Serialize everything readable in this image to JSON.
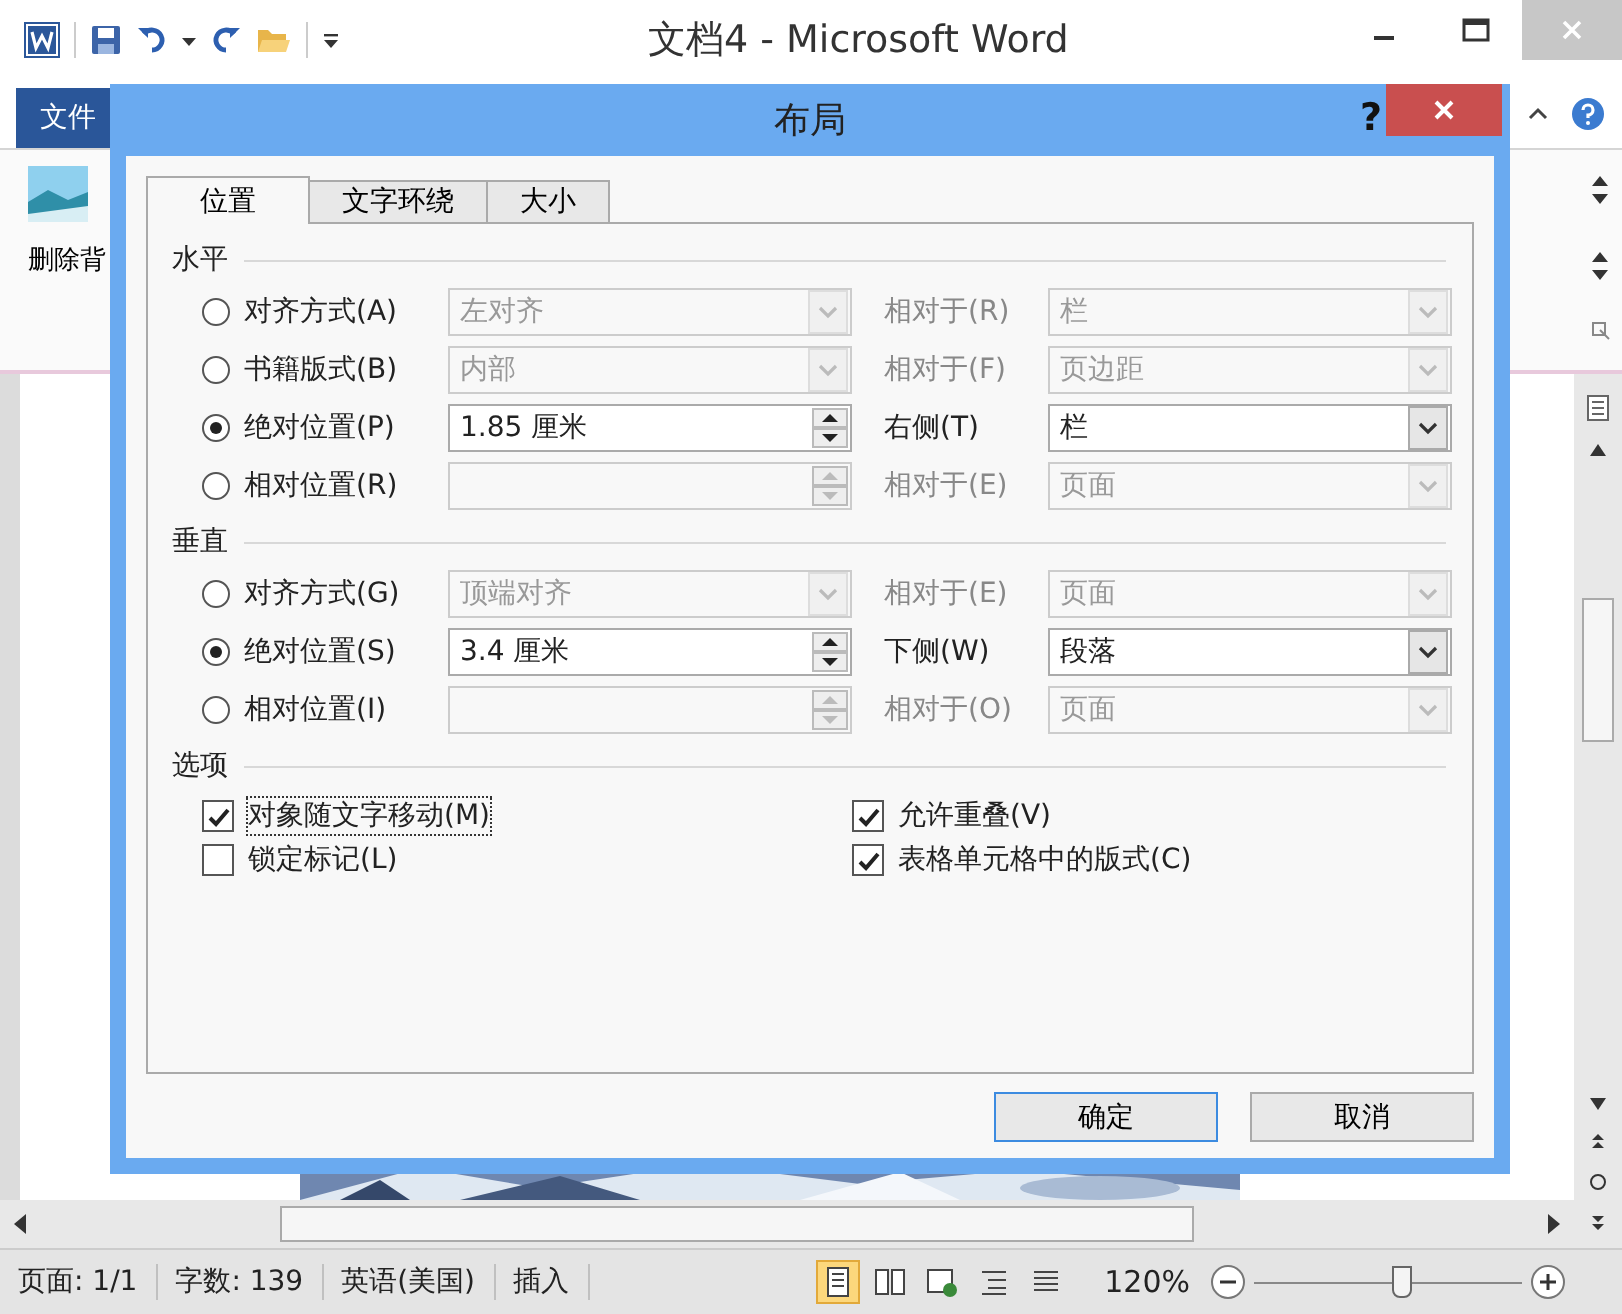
{
  "window": {
    "title": "文档4 - Microsoft Word"
  },
  "ribbon": {
    "file_tab": "文件",
    "button": "删除背"
  },
  "dialog": {
    "title": "布局",
    "help": "?",
    "tabs": [
      {
        "label": "位置",
        "selected": true
      },
      {
        "label": "文字环绕",
        "selected": false
      },
      {
        "label": "大小",
        "selected": false
      }
    ],
    "sections": [
      {
        "title": "水平",
        "rows": [
          {
            "label": "对齐方式(A)",
            "selected": false,
            "field": {
              "kind": "combo",
              "value": "左对齐",
              "disabled": true
            },
            "relation_label": "相对于(R)",
            "relation": {
              "value": "栏",
              "disabled": true
            }
          },
          {
            "label": "书籍版式(B)",
            "selected": false,
            "field": {
              "kind": "combo",
              "value": "内部",
              "disabled": true
            },
            "relation_label": "相对于(F)",
            "relation": {
              "value": "页边距",
              "disabled": true
            }
          },
          {
            "label": "绝对位置(P)",
            "selected": true,
            "field": {
              "kind": "spin",
              "value": "1.85 厘米",
              "disabled": false
            },
            "relation_label": "右侧(T)",
            "relation": {
              "value": "栏",
              "disabled": false
            }
          },
          {
            "label": "相对位置(R)",
            "selected": false,
            "field": {
              "kind": "spin",
              "disabled": true
            },
            "relation_label": "相对于(E)",
            "relation": {
              "value": "页面",
              "disabled": true
            }
          }
        ]
      },
      {
        "title": "垂直",
        "rows": [
          {
            "label": "对齐方式(G)",
            "selected": false,
            "field": {
              "kind": "combo",
              "value": "顶端对齐",
              "disabled": true
            },
            "relation_label": "相对于(E)",
            "relation": {
              "value": "页面",
              "disabled": true
            }
          },
          {
            "label": "绝对位置(S)",
            "selected": true,
            "field": {
              "kind": "spin",
              "value": "3.4 厘米",
              "disabled": false
            },
            "relation_label": "下侧(W)",
            "relation": {
              "value": "段落",
              "disabled": false
            }
          },
          {
            "label": "相对位置(I)",
            "selected": false,
            "field": {
              "kind": "spin",
              "disabled": true
            },
            "relation_label": "相对于(O)",
            "relation": {
              "value": "页面",
              "disabled": true
            }
          }
        ]
      }
    ],
    "options": {
      "title": "选项",
      "items": [
        {
          "label": "对象随文字移动(M)",
          "checked": true,
          "focused": true
        },
        {
          "label": "允许重叠(V)",
          "checked": true,
          "focused": false
        },
        {
          "label": "锁定标记(L)",
          "checked": false,
          "focused": false
        },
        {
          "label": "表格单元格中的版式(C)",
          "checked": true,
          "focused": false
        }
      ]
    },
    "buttons": [
      {
        "label": "确定",
        "default": true
      },
      {
        "label": "取消",
        "default": false
      }
    ]
  },
  "status_bar": {
    "items": [
      "页面: 1/1",
      "字数: 139",
      "英语(美国)",
      "插入"
    ],
    "zoom": "120%",
    "zoom_slider": {
      "level": 0.55
    }
  }
}
